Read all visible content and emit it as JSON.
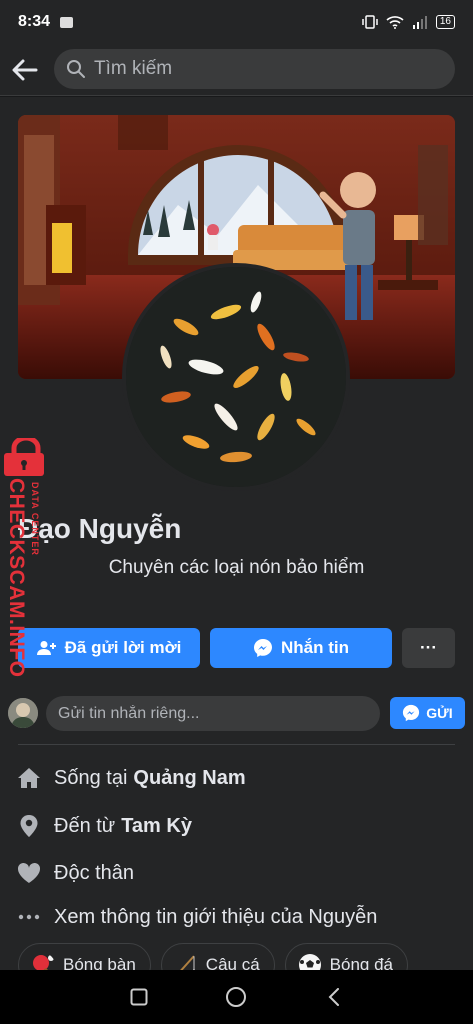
{
  "status_bar": {
    "time": "8:34",
    "battery": "16"
  },
  "search": {
    "placeholder": "Tìm kiếm"
  },
  "profile": {
    "name": "Đạo Nguyễn",
    "bio": "Chuyên các loại nón bảo hiểm"
  },
  "actions": {
    "request_sent": "Đã gửi lời mời",
    "message": "Nhắn tin",
    "more": "···"
  },
  "message_bar": {
    "placeholder": "Gửi tin nhắn riêng...",
    "send": "GỬI"
  },
  "intro": {
    "lives_prefix": "Sống tại",
    "lives_place": "Quảng Nam",
    "from_prefix": "Đến từ",
    "from_place": "Tam Kỳ",
    "relationship": "Độc thân",
    "see_more": "Xem thông tin giới thiệu của Nguyễn"
  },
  "hobbies": [
    "Bóng bàn",
    "Câu cá",
    "Bóng đá"
  ],
  "watermark": {
    "main": "CHECKSCAM.INFO",
    "sub": "DATA CENTER"
  },
  "colors": {
    "accent": "#2d88ff",
    "background": "#242526",
    "watermark": "#e4313a"
  }
}
